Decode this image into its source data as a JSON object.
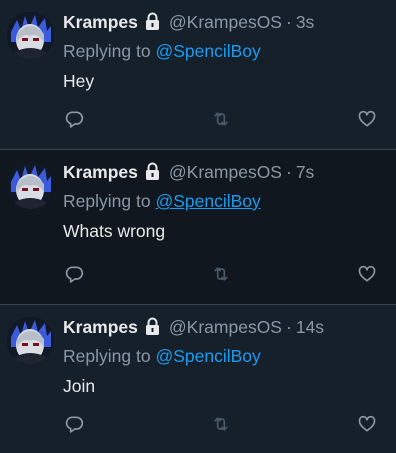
{
  "icons": {
    "lock": "lock-icon",
    "reply": "reply-icon",
    "retweet": "retweet-icon",
    "like": "heart-icon"
  },
  "colors": {
    "background": "#15202b",
    "hover_background": "#10171e",
    "link": "#1d9bf0",
    "muted": "#8b98a5",
    "text": "#e7e9ea",
    "divider": "#38444d"
  },
  "tweets": [
    {
      "name": "Krampes",
      "handle": "@KrampesOS",
      "separator": "·",
      "time": "3s",
      "replying_prefix": "Replying to",
      "replying_to": "@SpencilBoy",
      "text": "Hey"
    },
    {
      "name": "Krampes",
      "handle": "@KrampesOS",
      "separator": "·",
      "time": "7s",
      "replying_prefix": "Replying to",
      "replying_to": "@SpencilBoy",
      "text": "Whats wrong"
    },
    {
      "name": "Krampes",
      "handle": "@KrampesOS",
      "separator": "·",
      "time": "14s",
      "replying_prefix": "Replying to",
      "replying_to": "@SpencilBoy",
      "text": "Join"
    }
  ]
}
